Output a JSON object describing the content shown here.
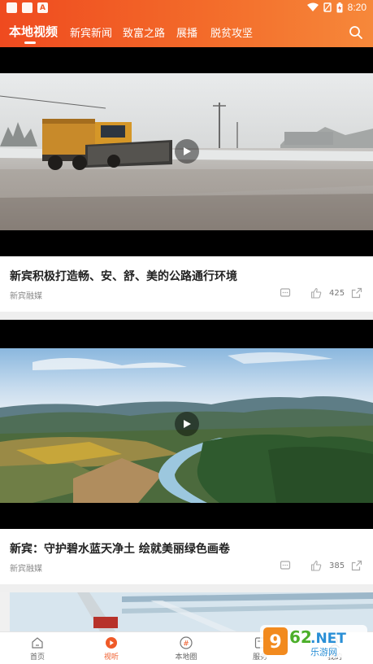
{
  "status_bar": {
    "time": "8:20"
  },
  "header": {
    "tabs": [
      {
        "label": "本地视频",
        "active": true
      },
      {
        "label": "新宾新闻",
        "active": false
      },
      {
        "label": "致富之路",
        "active": false
      },
      {
        "label": "展播",
        "active": false
      },
      {
        "label": "脱贫攻坚",
        "active": false
      }
    ]
  },
  "feed": [
    {
      "title": "新宾积极打造畅、安、舒、美的公路通行环境",
      "source": "新宾融媒",
      "likes": "425"
    },
    {
      "title": "新宾：守护碧水蓝天净土  绘就美丽绿色画卷",
      "source": "新宾融媒",
      "likes": "385"
    }
  ],
  "bottom_nav": [
    {
      "label": "首页",
      "icon": "home-icon",
      "active": false
    },
    {
      "label": "视听",
      "icon": "play-icon",
      "active": true
    },
    {
      "label": "本地圈",
      "icon": "hashtag-icon",
      "active": false
    },
    {
      "label": "服务",
      "icon": "service-icon",
      "active": false
    },
    {
      "label": "我的",
      "icon": "profile-icon",
      "active": false
    }
  ],
  "watermark": {
    "brand": "962.NET",
    "sub": "乐游网"
  },
  "colors": {
    "accent": "#ef5a28",
    "header_start": "#ef4a1f",
    "header_end": "#f6883a"
  }
}
